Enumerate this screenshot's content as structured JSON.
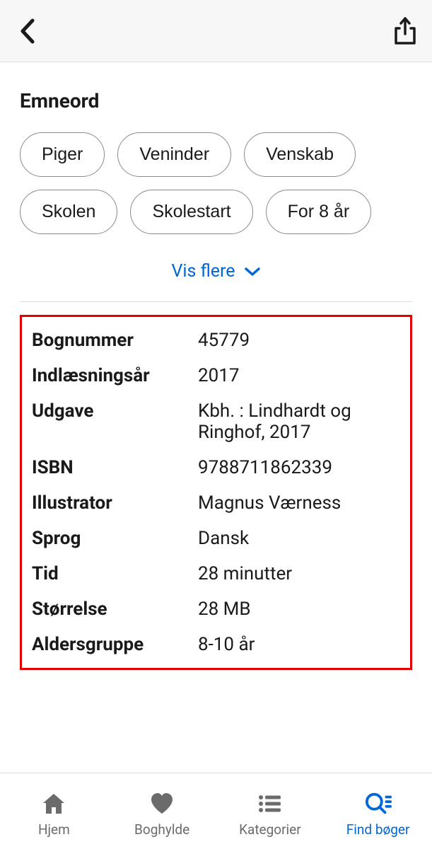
{
  "section_title": "Emneord",
  "tags": [
    "Piger",
    "Veninder",
    "Venskab",
    "Skolen",
    "Skolestart",
    "For 8 år"
  ],
  "show_more_label": "Vis flere",
  "details": [
    {
      "label": "Bognummer",
      "value": "45779"
    },
    {
      "label": "Indlæsningsår",
      "value": "2017"
    },
    {
      "label": "Udgave",
      "value": "Kbh. : Lindhardt og Ringhof, 2017"
    },
    {
      "label": "ISBN",
      "value": "9788711862339"
    },
    {
      "label": "Illustrator",
      "value": "Magnus Værness"
    },
    {
      "label": "Sprog",
      "value": "Dansk"
    },
    {
      "label": "Tid",
      "value": "28 minutter"
    },
    {
      "label": "Størrelse",
      "value": "28 MB"
    },
    {
      "label": "Aldersgruppe",
      "value": "8-10 år"
    }
  ],
  "tabs": [
    {
      "label": "Hjem",
      "icon": "home-icon",
      "active": false
    },
    {
      "label": "Boghylde",
      "icon": "heart-icon",
      "active": false
    },
    {
      "label": "Kategorier",
      "icon": "list-icon",
      "active": false
    },
    {
      "label": "Find bøger",
      "icon": "search-icon",
      "active": true
    }
  ],
  "colors": {
    "accent": "#0068d6",
    "highlight_border": "#e20000",
    "inactive": "#6b6b6b"
  }
}
